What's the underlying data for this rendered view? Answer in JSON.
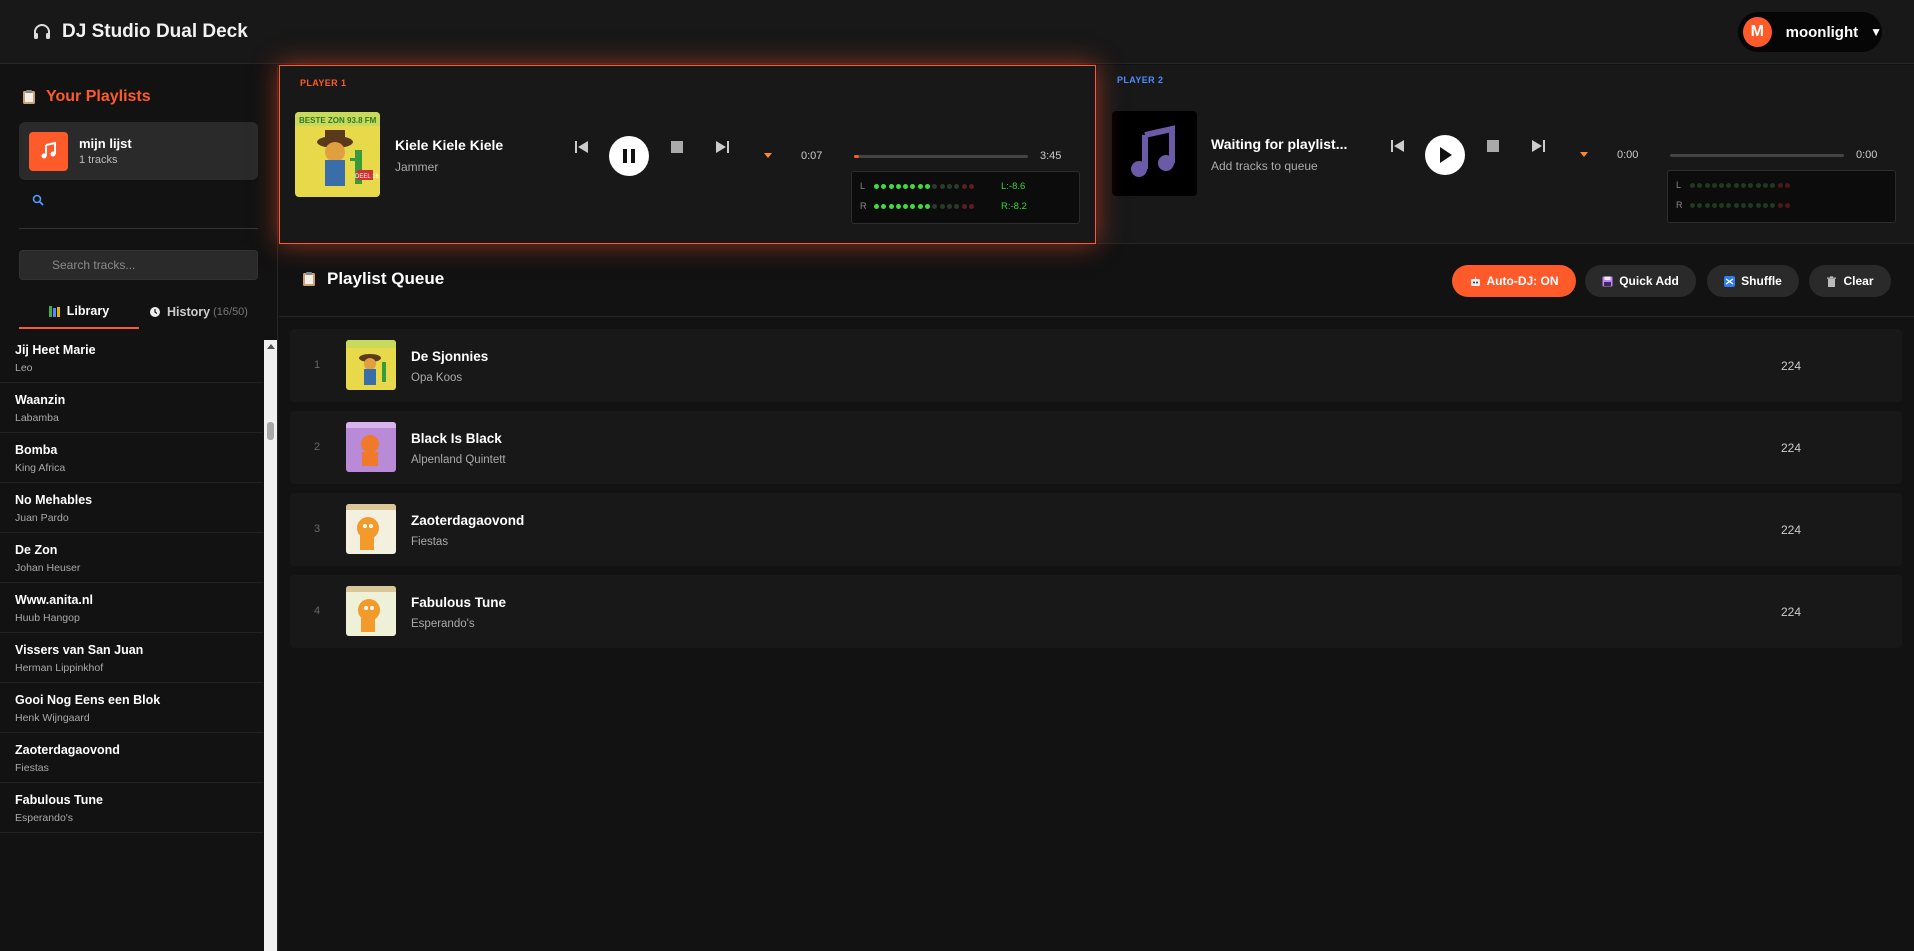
{
  "header": {
    "app_title": "DJ Studio Dual Deck",
    "user_initial": "M",
    "user_name": "moonlight"
  },
  "sidebar": {
    "playlists_title": "Your Playlists",
    "playlist": {
      "name": "mijn lijst",
      "count": "1 tracks"
    },
    "search_placeholder": "Search tracks...",
    "tab_library": "Library",
    "tab_history": "History",
    "tab_history_count": "(16/50)",
    "library": [
      {
        "title": "Jij Heet Marie",
        "artist": "Leo"
      },
      {
        "title": "Waanzin",
        "artist": "Labamba"
      },
      {
        "title": "Bomba",
        "artist": "King Africa"
      },
      {
        "title": "No Mehables",
        "artist": "Juan Pardo"
      },
      {
        "title": "De Zon",
        "artist": "Johan Heuser"
      },
      {
        "title": "Www.anita.nl",
        "artist": "Huub Hangop"
      },
      {
        "title": "Vissers van San Juan",
        "artist": "Herman Lippinkhof"
      },
      {
        "title": "Gooi Nog Eens een Blok",
        "artist": "Henk Wijngaard"
      },
      {
        "title": "Zaoterdagaovond",
        "artist": "Fiestas"
      },
      {
        "title": "Fabulous Tune",
        "artist": "Esperando's"
      }
    ]
  },
  "player1": {
    "label": "PLAYER 1",
    "title": "Kiele Kiele Kiele",
    "artist": "Jammer",
    "time_current": "0:07",
    "time_total": "3:45",
    "progress": 0.03,
    "vu_left_label": "L",
    "vu_right_label": "R",
    "vu_left_value": "L:-8.6",
    "vu_right_value": "R:-8.2",
    "vu_left_level": 8,
    "vu_right_level": 8
  },
  "player2": {
    "label": "PLAYER 2",
    "title": "Waiting for playlist...",
    "artist": "Add tracks to queue",
    "time_current": "0:00",
    "time_total": "0:00",
    "progress": 0,
    "vu_left_label": "L",
    "vu_right_label": "R",
    "vu_left_level": 0,
    "vu_right_level": 0
  },
  "queue": {
    "title": "Playlist Queue",
    "btn_autodj": "Auto-DJ: ON",
    "btn_quickadd": "Quick Add",
    "btn_shuffle": "Shuffle",
    "btn_clear": "Clear",
    "rows": [
      {
        "num": "1",
        "title": "De Sjonnies",
        "artist": "Opa Koos",
        "duration": "224"
      },
      {
        "num": "2",
        "title": "Black Is Black",
        "artist": "Alpenland Quintett",
        "duration": "224"
      },
      {
        "num": "3",
        "title": "Zaoterdagaovond",
        "artist": "Fiestas",
        "duration": "224"
      },
      {
        "num": "4",
        "title": "Fabulous Tune",
        "artist": "Esperando's",
        "duration": "224"
      }
    ]
  },
  "colors": {
    "accent": "#ff5a2a",
    "player2_accent": "#4e8cff",
    "vu_green": "#37d637"
  },
  "icons": [
    "headphones-icon",
    "clipboard-icon",
    "music-note-icon",
    "search-icon",
    "books-icon",
    "clock-icon",
    "previous-icon",
    "pause-icon",
    "play-icon",
    "stop-icon",
    "next-icon",
    "robot-icon",
    "floppy-icon",
    "shuffle-icon",
    "trash-icon"
  ]
}
